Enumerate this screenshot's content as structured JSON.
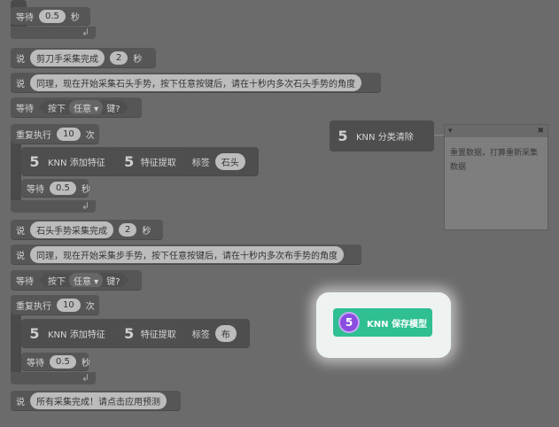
{
  "blocks": {
    "wait1": {
      "label": "等待",
      "value": "0.5",
      "unit": "秒"
    },
    "say_scissors_done": {
      "label": "说",
      "text": "剪刀手采集完成",
      "value": "2",
      "unit": "秒"
    },
    "say_rock_prompt": {
      "label": "说",
      "text": "同理，现在开始采集石头手势，按下任意按键后，请在十秒内多次石头手势的角度"
    },
    "wait_key1": {
      "label": "等待",
      "press": "按下",
      "key": "任意",
      "suffix": "键?"
    },
    "repeat1": {
      "label": "重复执行",
      "value": "10",
      "unit": "次"
    },
    "knn_add1": {
      "num": "5",
      "label": "KNN 添加特征",
      "num2": "5",
      "feature": "特征提取",
      "tag_label": "标签",
      "tag": "石头"
    },
    "wait2": {
      "label": "等待",
      "value": "0.5",
      "unit": "秒"
    },
    "say_rock_done": {
      "label": "说",
      "text": "石头手势采集完成",
      "value": "2",
      "unit": "秒"
    },
    "say_cloth_prompt": {
      "label": "说",
      "text": "同理，现在开始采集步手势，按下任意按键后，请在十秒内多次布手势的角度"
    },
    "wait_key2": {
      "label": "等待",
      "press": "按下",
      "key": "任意",
      "suffix": "键?"
    },
    "repeat2": {
      "label": "重复执行",
      "value": "10",
      "unit": "次"
    },
    "knn_add2": {
      "num": "5",
      "label": "KNN 添加特征",
      "num2": "5",
      "feature": "特征提取",
      "tag_label": "标签",
      "tag": "布"
    },
    "wait3": {
      "label": "等待",
      "value": "0.5",
      "unit": "秒"
    },
    "say_all_done": {
      "label": "说",
      "text": "所有采集完成！请点击应用预测"
    },
    "knn_clear": {
      "num": "5",
      "label": "KNN 分类清除"
    },
    "knn_save": {
      "num": "5",
      "label": "KNN 保存模型"
    }
  },
  "note": {
    "text": "重置数据，打算重新采集数据",
    "collapse": "▾",
    "close": "✖"
  },
  "colors": {
    "background": "#6b6b6b",
    "block": "#565656",
    "highlight": "#2fbf92",
    "badge": "#8a4de0"
  }
}
